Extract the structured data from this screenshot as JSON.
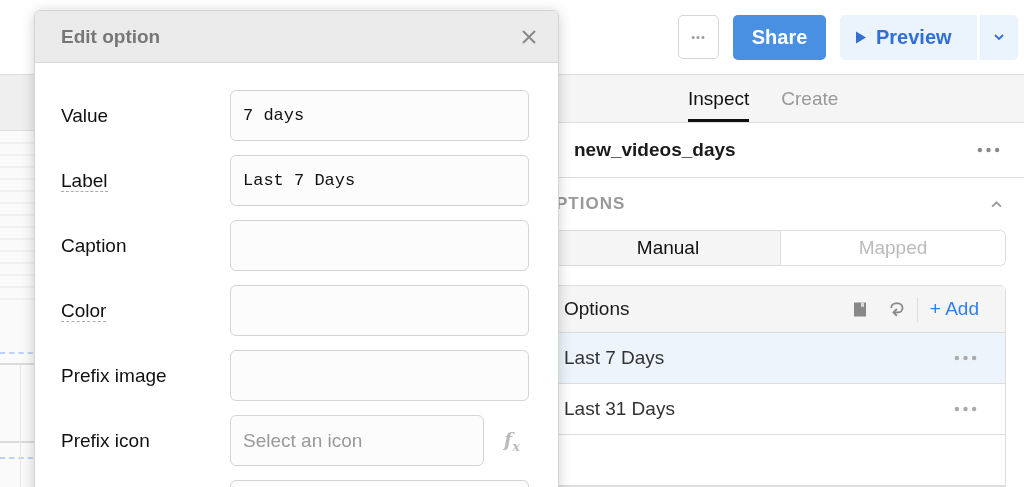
{
  "top_bar": {
    "more_button": "•••",
    "share_button": "Share",
    "preview_button": "Preview"
  },
  "panel": {
    "tabs": [
      {
        "label": "Inspect",
        "selected": true
      },
      {
        "label": "Create",
        "selected": false
      }
    ],
    "component_name": "new_videos_days",
    "section_title": "PTIONS",
    "expanded": true,
    "modes": [
      {
        "label": "Manual",
        "selected": true
      },
      {
        "label": "Mapped",
        "selected": false
      }
    ],
    "options_header": "Options",
    "add_button": "+ Add",
    "options": [
      {
        "label": "Last 7 Days",
        "selected": true
      },
      {
        "label": "Last 31 Days",
        "selected": false
      }
    ]
  },
  "modal": {
    "title": "Edit option",
    "fields": [
      {
        "kind": "text",
        "label": "Value",
        "value": "7 days"
      },
      {
        "kind": "text",
        "label": "Label",
        "value": "Last 7 Days",
        "hint": true
      },
      {
        "kind": "text",
        "label": "Caption"
      },
      {
        "kind": "text",
        "label": "Color",
        "hint": true
      },
      {
        "kind": "text",
        "label": "Prefix image"
      },
      {
        "kind": "icon",
        "label": "Prefix icon",
        "placeholder": "Select an icon",
        "formula_button": "f$_{x}$"
      },
      {
        "kind": "text"
      }
    ]
  }
}
